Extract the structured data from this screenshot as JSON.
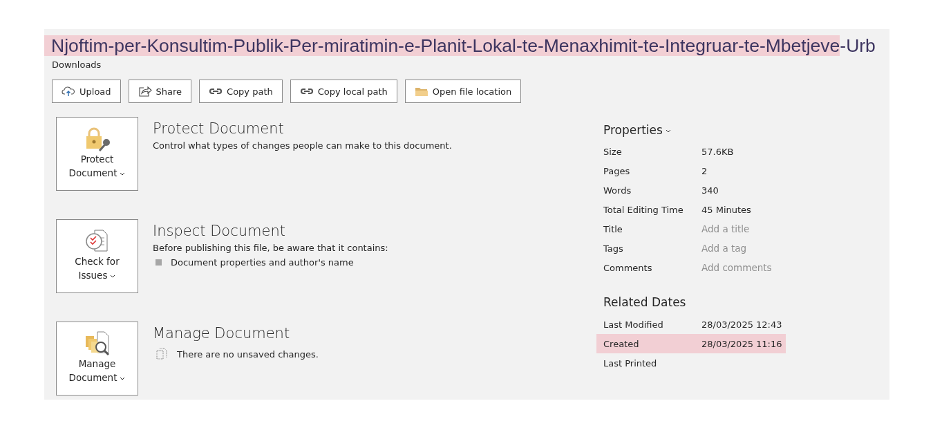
{
  "file_title": [
    {
      "text": "Njoftim-per-Konsultim-Publik-Per-miratimin-e-Planit-Lokal-te-Menaxhimit-te-Integruar-te-Mbetjeve",
      "highlighted": true
    },
    {
      "text": "-Urb",
      "highlighted": false
    }
  ],
  "location": "Downloads",
  "toolbar": [
    {
      "label": "Upload"
    },
    {
      "label": "Share"
    },
    {
      "label": "Copy path"
    },
    {
      "label": "Copy local path"
    },
    {
      "label": "Open file location"
    }
  ],
  "sections": [
    {
      "button": [
        "Protect",
        "Document"
      ],
      "title": "Protect Document",
      "description": "Control what types of changes people can make to this document."
    },
    {
      "button": [
        "Check for",
        "Issues"
      ],
      "title": "Inspect Document",
      "description": "Before publishing this file, be aware that it contains:",
      "bullets": [
        {
          "kind": "square",
          "text": "Document properties and author's name"
        }
      ]
    },
    {
      "button": [
        "Manage",
        "Document"
      ],
      "title": "Manage Document",
      "bullets": [
        {
          "kind": "pages",
          "text": "There are no unsaved changes."
        }
      ]
    }
  ],
  "properties": {
    "title": "Properties",
    "rows": [
      {
        "label": "Size",
        "value": "57.6KB"
      },
      {
        "label": "Pages",
        "value": "2"
      },
      {
        "label": "Words",
        "value": "340"
      },
      {
        "label": "Total Editing Time",
        "value": "45 Minutes"
      },
      {
        "label": "Title",
        "placeholder": "Add a title"
      },
      {
        "label": "Tags",
        "placeholder": "Add a tag"
      },
      {
        "label": "Comments",
        "placeholder": "Add comments"
      }
    ]
  },
  "related_dates": {
    "title": "Related Dates",
    "rows": [
      {
        "label": "Last Modified",
        "value": "28/03/2025 12:43",
        "highlighted": false
      },
      {
        "label": "Created",
        "value": "28/03/2025 11:16",
        "highlighted": true
      },
      {
        "label": "Last Printed",
        "highlighted": false
      }
    ]
  }
}
